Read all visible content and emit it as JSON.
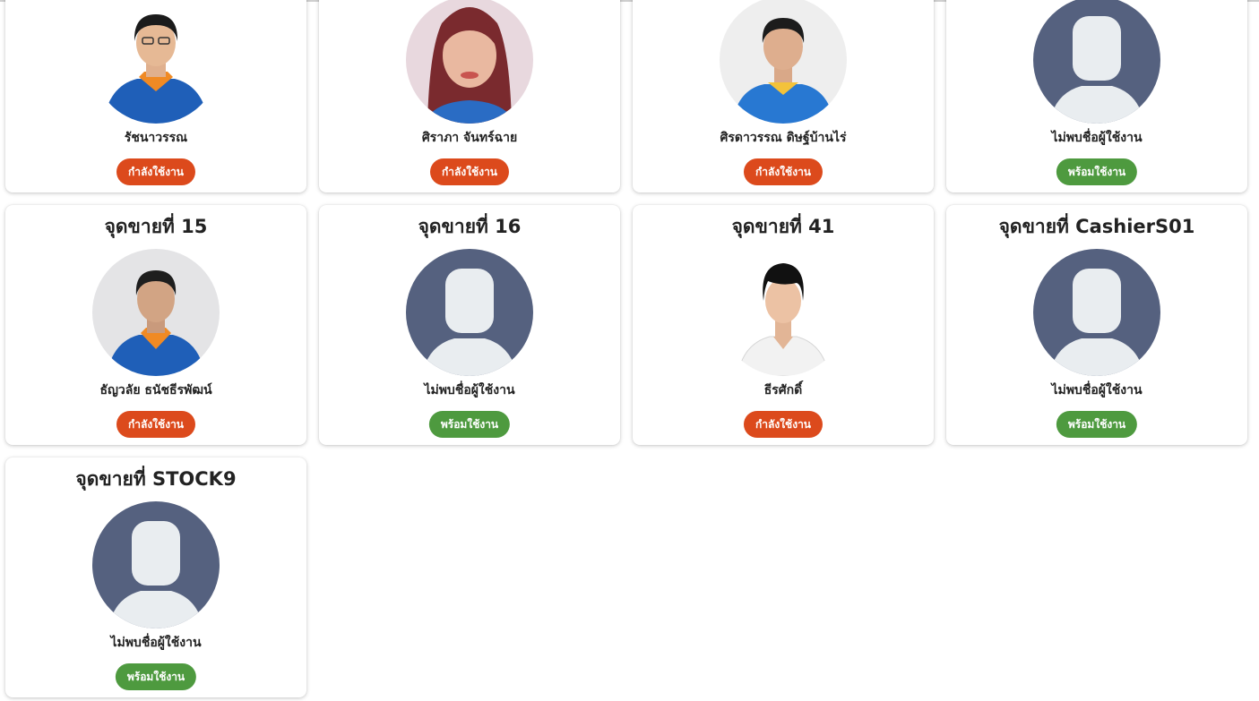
{
  "colors": {
    "busy": "#dc4a1c",
    "ready": "#4e9a3f",
    "placeholder_bg": "#55617f",
    "placeholder_fg": "#e9edf0"
  },
  "cards": [
    {
      "title": "",
      "user_name": "รัชนาวรรณ",
      "status": "กำลังใช้งาน",
      "avatar_icon": "employee-photo-icon"
    },
    {
      "title": "",
      "user_name": "ศิราภา จันทร์ฉาย",
      "status": "กำลังใช้งาน",
      "avatar_icon": "employee-photo-icon"
    },
    {
      "title": "",
      "user_name": "ศิรดาวรรณ ดิษฐ์บ้านไร่",
      "status": "กำลังใช้งาน",
      "avatar_icon": "employee-photo-icon"
    },
    {
      "title": "",
      "user_name": "ไม่พบชื่อผู้ใช้งาน",
      "status": "พร้อมใช้งาน",
      "avatar_icon": "default-user-icon"
    },
    {
      "title": "จุดขายที่ 15",
      "user_name": "ธัญวลัย ธนัชธีรพัฒน์",
      "status": "กำลังใช้งาน",
      "avatar_icon": "employee-photo-icon"
    },
    {
      "title": "จุดขายที่ 16",
      "user_name": "ไม่พบชื่อผู้ใช้งาน",
      "status": "พร้อมใช้งาน",
      "avatar_icon": "default-user-icon"
    },
    {
      "title": "จุดขายที่ 41",
      "user_name": "ธีรศักดิ์",
      "status": "กำลังใช้งาน",
      "avatar_icon": "employee-photo-icon"
    },
    {
      "title": "จุดขายที่ CashierS01",
      "user_name": "ไม่พบชื่อผู้ใช้งาน",
      "status": "พร้อมใช้งาน",
      "avatar_icon": "default-user-icon"
    },
    {
      "title": "จุดขายที่ STOCK9",
      "user_name": "ไม่พบชื่อผู้ใช้งาน",
      "status": "พร้อมใช้งาน",
      "avatar_icon": "default-user-icon"
    }
  ]
}
